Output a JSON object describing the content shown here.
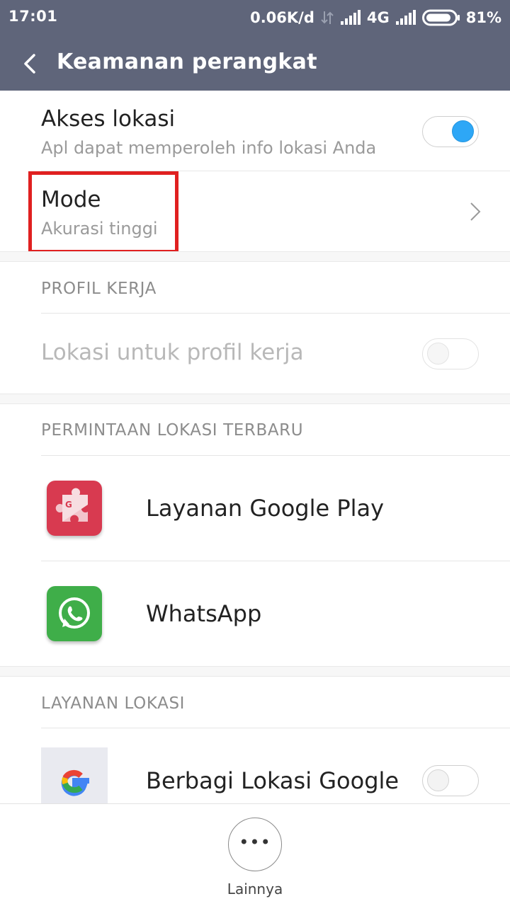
{
  "status_bar": {
    "time": "17:01",
    "speed": "0.06K/d",
    "network": "4G",
    "battery": "81%"
  },
  "app_bar": {
    "title": "Keamanan perangkat"
  },
  "location_access": {
    "title": "Akses lokasi",
    "subtitle": "Apl dapat memperoleh info lokasi Anda",
    "enabled": true
  },
  "mode": {
    "title": "Mode",
    "subtitle": "Akurasi tinggi"
  },
  "work_profile": {
    "header": "PROFIL KERJA",
    "item_label": "Lokasi untuk profil kerja",
    "enabled": false
  },
  "recent_requests": {
    "header": "PERMINTAAN LOKASI TERBARU",
    "apps": [
      {
        "name": "Layanan Google Play",
        "icon": "google-play-services-icon"
      },
      {
        "name": "WhatsApp",
        "icon": "whatsapp-icon"
      }
    ]
  },
  "location_services": {
    "header": "LAYANAN LOKASI",
    "items": [
      {
        "name": "Berbagi Lokasi Google",
        "icon": "google-g-icon",
        "enabled": false
      }
    ]
  },
  "bottom_bar": {
    "more_label": "Lainnya",
    "more_icon": "more-dots-icon"
  },
  "colors": {
    "header_bg": "#5f657a",
    "toggle_on": "#2ea7f6",
    "highlight": "#e02020"
  }
}
